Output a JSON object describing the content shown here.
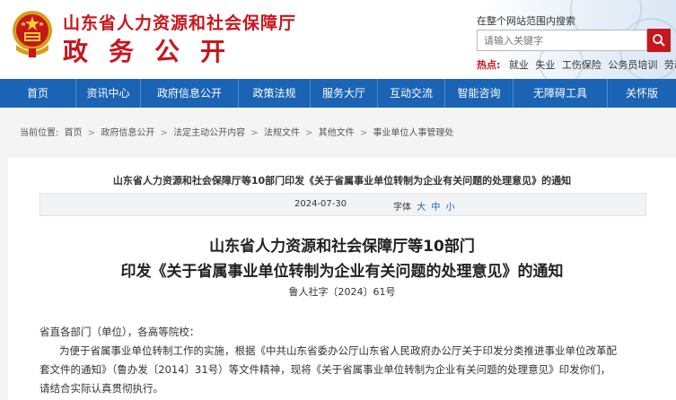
{
  "header": {
    "site_title": "山东省人力资源和社会保障厅",
    "section_title": "政务公开",
    "scope_text": "在整个网站范围内搜索",
    "search_placeholder": "请输入关键字",
    "hot_label": "热点:",
    "hot_items": [
      "就业",
      "失业",
      "工伤保险",
      "公务员培训",
      "劳动工资"
    ]
  },
  "nav": {
    "items": [
      "首页",
      "资讯中心",
      "政府信息公开",
      "政策法规",
      "服务大厅",
      "互动交流",
      "智能咨询",
      "无障碍工具",
      "关怀版"
    ]
  },
  "breadcrumb": {
    "prefix": "当前位置:",
    "items": [
      "首页",
      "政府信息公开",
      "法定主动公开内容",
      "法规文件",
      "其他文件",
      "事业单位人事管理处"
    ],
    "separator": ">"
  },
  "article": {
    "notice_title": "山东省人力资源和社会保障厅等10部门印发《关于省属事业单位转制为企业有关问题的处理意见》的通知",
    "date": "2024-07-30",
    "font_size_label": "字体",
    "font_size_options": [
      "大",
      "中",
      "小"
    ],
    "title_line1": "山东省人力资源和社会保障厅等10部门",
    "title_line2": "印发《关于省属事业单位转制为企业有关问题的处理意见》的通知",
    "doc_number": "鲁人社字〔2024〕61号",
    "salutation": "省直各部门（单位），各高等院校：",
    "body_lines": [
      "为便于省属事业单位转制工作的实施，根据《中共山东省委办公厅山东省人民政府办公厅关于印发分类推进事业单位改革配",
      "套文件的通知》（鲁办发〔2014〕31号）等文件精神，现将《关于省属事业单位转制为企业有关问题的处理意见》印发你们，",
      "请结合实际认真贯彻执行。"
    ]
  },
  "colors": {
    "brand_red": "#c8161d",
    "nav_blue": "#1a63b5"
  },
  "icons": {
    "emblem": "national-emblem-icon",
    "search": "search-icon"
  }
}
